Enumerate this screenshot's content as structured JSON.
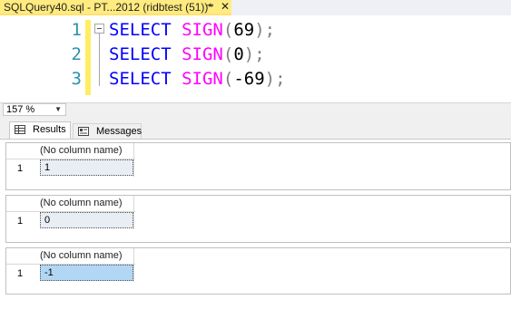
{
  "tab": {
    "title": "SQLQuery40.sql - PT...2012 (ridbtest (51))*",
    "pin_icon": "pin-icon",
    "close_glyph": "✕"
  },
  "editor": {
    "lines": [
      {
        "number": "1",
        "keyword": "SELECT",
        "function": "SIGN",
        "open": "(",
        "arg": "69",
        "close": ");"
      },
      {
        "number": "2",
        "keyword": "SELECT",
        "function": "SIGN",
        "open": "(",
        "arg": "0",
        "close": ");"
      },
      {
        "number": "3",
        "keyword": "SELECT",
        "function": "SIGN",
        "open": "(",
        "arg": "-69",
        "close": ");"
      }
    ],
    "colors": {
      "keyword": "#0000ff",
      "function": "#ff00ff",
      "punctuation": "#808080",
      "line_number": "#2b91af"
    }
  },
  "zoom": {
    "value": "157 %"
  },
  "results_tabs": [
    {
      "label": "Results",
      "icon": "grid-icon",
      "active": true
    },
    {
      "label": "Messages",
      "icon": "messages-icon",
      "active": false
    }
  ],
  "result_grids": [
    {
      "column_header": "(No column name)",
      "row_number": "1",
      "value": "1",
      "selected": false
    },
    {
      "column_header": "(No column name)",
      "row_number": "1",
      "value": "0",
      "selected": false
    },
    {
      "column_header": "(No column name)",
      "row_number": "1",
      "value": "-1",
      "selected": true
    }
  ]
}
